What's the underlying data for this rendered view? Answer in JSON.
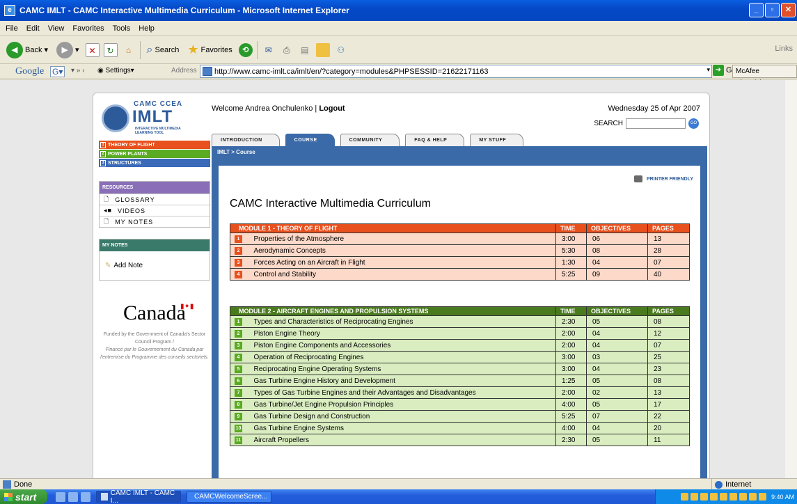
{
  "window": {
    "title": "CAMC IMLT - CAMC Interactive Multimedia Curriculum - Microsoft Internet Explorer"
  },
  "menu": [
    "File",
    "Edit",
    "View",
    "Favorites",
    "Tools",
    "Help"
  ],
  "toolbar": {
    "back": "Back",
    "search": "Search",
    "favorites": "Favorites",
    "links": "Links"
  },
  "addressbar": {
    "google": "Google",
    "settings": "Settings",
    "address_label": "Address",
    "url": "http://www.camc-imlt.ca/imlt/en/?category=modules&PHPSESSID=21622171163",
    "go": "Go",
    "mcafee": "McAfee SiteAdvisor"
  },
  "logo": {
    "camc": "CAMC CCEA",
    "imlt": "IMLT",
    "sub": "INTERACTIVE MULTIMEDIA LEARNING TOOL"
  },
  "modules_nav": [
    {
      "num": "1",
      "label": "THEORY OF FLIGHT",
      "color": "#e8501e"
    },
    {
      "num": "2",
      "label": "POWER PLANTS",
      "color": "#5aaa22"
    },
    {
      "num": "3",
      "label": "STRUCTURES",
      "color": "#3a6ab8"
    }
  ],
  "resources": {
    "heading": "RESOURCES",
    "items": [
      "GLOSSARY",
      "VIDEOS",
      "MY NOTES"
    ]
  },
  "my_notes": {
    "heading": "MY NOTES",
    "add": "Add Note"
  },
  "canada": {
    "wordmark": "Canada",
    "funded_1": "Funded by the Government of Canada's Sector Council Program /",
    "funded_2": "Financé par le Gouvernement du Canada par l'entremise du Programme des conseils sectoriels."
  },
  "header": {
    "welcome": "Welcome Andrea Onchulenko |",
    "logout": "Logout",
    "date": "Wednesday 25 of Apr 2007",
    "search_label": "SEARCH",
    "go": "GO"
  },
  "tabs": [
    "INTRODUCTION",
    "COURSE",
    "COMMUNITY",
    "FAQ & HELP",
    "MY STUFF"
  ],
  "breadcrumb": "IMLT > Course",
  "printer": "PRINTER FRIENDLY",
  "page_title": "CAMC Interactive Multimedia Curriculum",
  "module1": {
    "title": "MODULE 1 - THEORY OF FLIGHT",
    "col_time": "TIME",
    "col_obj": "OBJECTIVES",
    "col_pages": "PAGES",
    "rows": [
      {
        "n": "1",
        "name": "Properties of the Atmosphere",
        "time": "3:00",
        "obj": "06",
        "pages": "13"
      },
      {
        "n": "2",
        "name": "Aerodynamic Concepts",
        "time": "5:30",
        "obj": "08",
        "pages": "28"
      },
      {
        "n": "3",
        "name": "Forces Acting on an Aircraft in Flight",
        "time": "1:30",
        "obj": "04",
        "pages": "07"
      },
      {
        "n": "4",
        "name": "Control and Stability",
        "time": "5:25",
        "obj": "09",
        "pages": "40"
      }
    ]
  },
  "module2": {
    "title": "MODULE 2 - AIRCRAFT ENGINES AND PROPULSION SYSTEMS",
    "col_time": "TIME",
    "col_obj": "OBJECTIVES",
    "col_pages": "PAGES",
    "rows": [
      {
        "n": "1",
        "name": "Types and Characteristics of Reciprocating Engines",
        "time": "2:30",
        "obj": "05",
        "pages": "08"
      },
      {
        "n": "2",
        "name": "Piston Engine Theory",
        "time": "2:00",
        "obj": "04",
        "pages": "12"
      },
      {
        "n": "3",
        "name": "Piston Engine Components and Accessories",
        "time": "2:00",
        "obj": "04",
        "pages": "07"
      },
      {
        "n": "4",
        "name": "Operation of Reciprocating Engines",
        "time": "3:00",
        "obj": "03",
        "pages": "25"
      },
      {
        "n": "5",
        "name": "Reciprocating Engine Operating Systems",
        "time": "3:00",
        "obj": "04",
        "pages": "23"
      },
      {
        "n": "6",
        "name": "Gas Turbine Engine History and Development",
        "time": "1:25",
        "obj": "05",
        "pages": "08"
      },
      {
        "n": "7",
        "name": "Types of Gas Turbine Engines and their Advantages and Disadvantages",
        "time": "2:00",
        "obj": "02",
        "pages": "13"
      },
      {
        "n": "8",
        "name": "Gas Turbine/Jet Engine Propulsion Principles",
        "time": "4:00",
        "obj": "05",
        "pages": "17"
      },
      {
        "n": "9",
        "name": "Gas Turbine Design and Construction",
        "time": "5:25",
        "obj": "07",
        "pages": "22"
      },
      {
        "n": "10",
        "name": "Gas Turbine Engine Systems",
        "time": "4:00",
        "obj": "04",
        "pages": "20"
      },
      {
        "n": "11",
        "name": "Aircraft Propellers",
        "time": "2:30",
        "obj": "05",
        "pages": "11"
      }
    ]
  },
  "status": {
    "text": "Done",
    "zone": "Internet"
  },
  "taskbar": {
    "start": "start",
    "tasks": [
      "CAMC IMLT - CAMC I...",
      "CAMCWelcomeScree..."
    ],
    "clock": "9:40 AM"
  }
}
